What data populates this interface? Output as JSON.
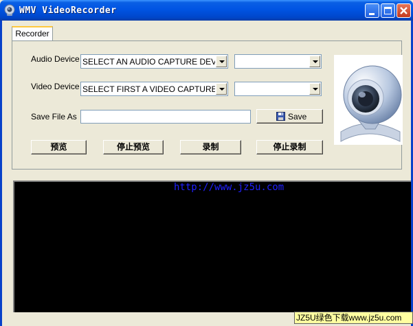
{
  "window": {
    "title": "WMV VideoRecorder"
  },
  "tabs": [
    {
      "label": "Recorder"
    }
  ],
  "form": {
    "audio_label": "Audio Device",
    "audio_device_value": "SELECT AN AUDIO CAPTURE DEVICE",
    "audio_format_value": "",
    "video_label": "Video Device",
    "video_device_value": "SELECT FIRST A VIDEO CAPTURE DEVICE",
    "video_format_value": "",
    "save_label": "Save File As",
    "save_path_value": "",
    "save_button": "Save"
  },
  "actions": {
    "preview": "预览",
    "stop_preview": "停止预览",
    "record": "录制",
    "stop_record": "停止录制"
  },
  "overlay": {
    "url": "http://www.jz5u.com",
    "watermark": "JZ5U绿色下载www.jz5u.com"
  },
  "icons": {
    "app": "webcam-icon",
    "save": "floppy-disk-icon",
    "webcam_image": "webcam-illustration"
  },
  "colors": {
    "titlebar": "#0054e3",
    "video_bg": "#000000",
    "url_text": "#2020ff",
    "watermark_bg": "#ffffa0"
  }
}
